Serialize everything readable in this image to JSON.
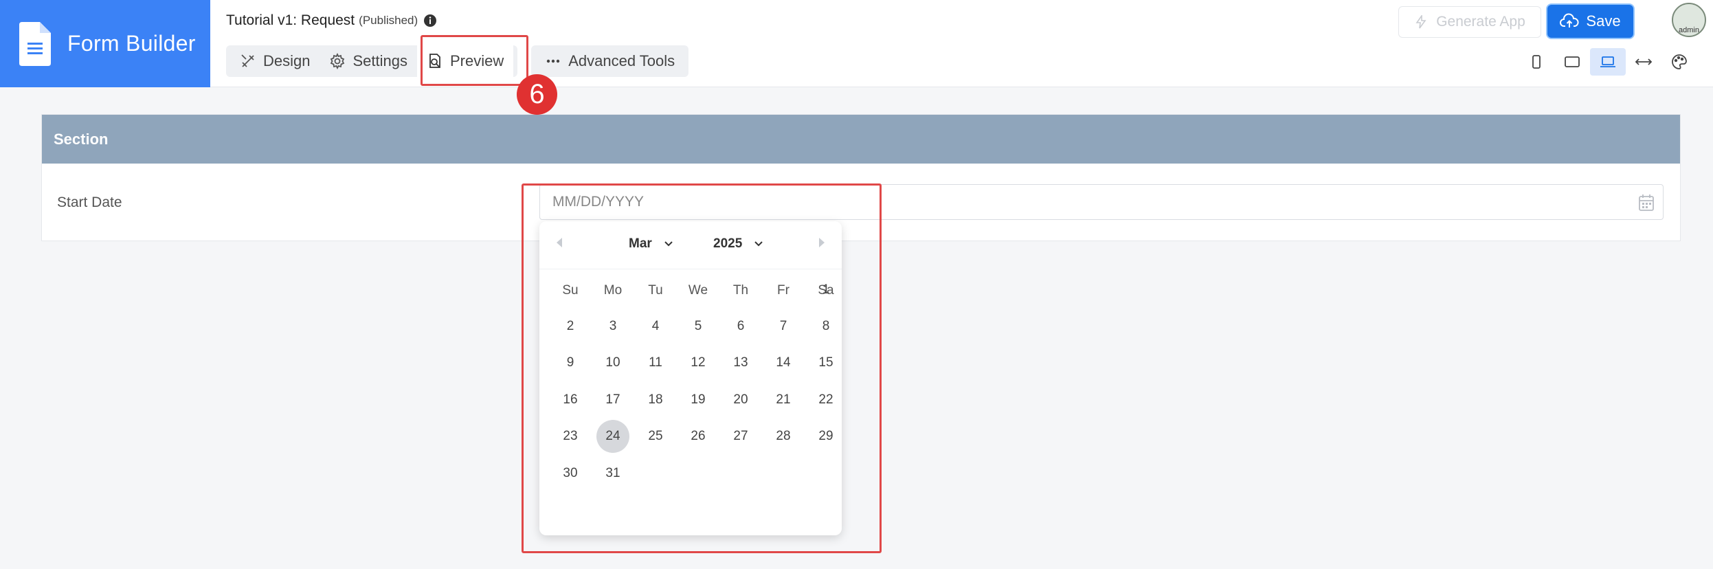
{
  "app": {
    "title": "Form Builder"
  },
  "document": {
    "title": "Tutorial v1: Request",
    "status": "(Published)"
  },
  "tabs": [
    {
      "label": "Design",
      "icon": "design-tools-icon"
    },
    {
      "label": "Settings",
      "icon": "gear-icon"
    },
    {
      "label": "Preview",
      "icon": "preview-icon",
      "active": true
    }
  ],
  "advanced_tools": {
    "label": "Advanced Tools"
  },
  "annotation": {
    "step": "6"
  },
  "toolbar": {
    "generate_label": "Generate App",
    "save_label": "Save"
  },
  "user": {
    "avatar_text": "admin"
  },
  "device_buttons": [
    "mobile-icon",
    "tablet-icon",
    "laptop-icon",
    "full-width-icon",
    "palette-icon"
  ],
  "form": {
    "section_title": "Section",
    "field_label": "Start Date",
    "date_placeholder": "MM/DD/YYYY"
  },
  "calendar": {
    "month": "Mar",
    "year": "2025",
    "weekdays": [
      "Su",
      "Mo",
      "Tu",
      "We",
      "Th",
      "Fr",
      "Sa"
    ],
    "weeks": [
      [
        "",
        "",
        "",
        "",
        "",
        "",
        "1"
      ],
      [
        "2",
        "3",
        "4",
        "5",
        "6",
        "7",
        "8"
      ],
      [
        "9",
        "10",
        "11",
        "12",
        "13",
        "14",
        "15"
      ],
      [
        "16",
        "17",
        "18",
        "19",
        "20",
        "21",
        "22"
      ],
      [
        "23",
        "24",
        "25",
        "26",
        "27",
        "28",
        "29"
      ],
      [
        "30",
        "31",
        "",
        "",
        "",
        "",
        ""
      ]
    ],
    "selected": "24"
  },
  "colors": {
    "brand": "#3b82f6",
    "save": "#1a73e8",
    "section_header": "#8fa5bb",
    "highlight": "#e04848"
  }
}
